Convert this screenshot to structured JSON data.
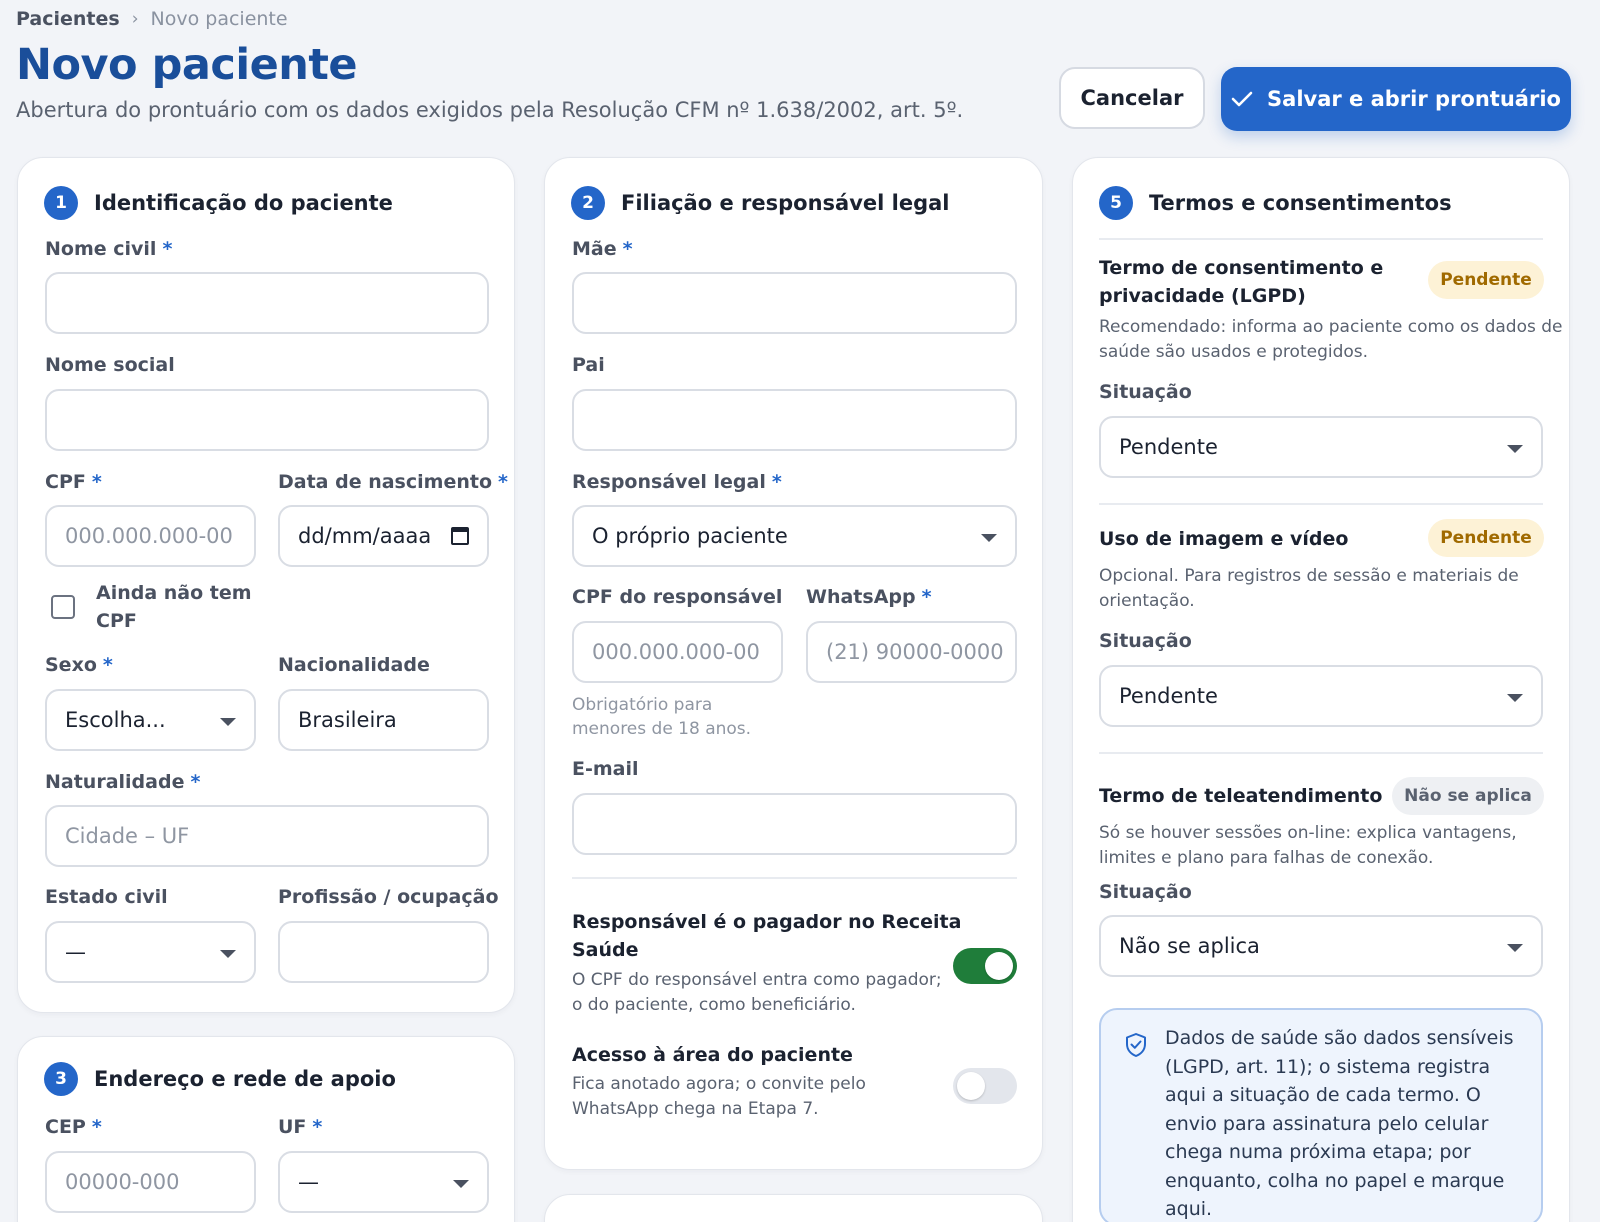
{
  "breadcrumb": {
    "parent": "Pacientes",
    "separator": "›",
    "current": "Novo paciente"
  },
  "page": {
    "title": "Novo paciente",
    "subtitle": "Abertura do prontuário com os dados exigidos pela Resolução CFM nº 1.638/2002, art. 5º."
  },
  "actions": {
    "cancel": "Cancelar",
    "save": "Salvar e abrir prontuário",
    "save_icon": "check-icon"
  },
  "colors": {
    "accent": "#2466c9",
    "title": "#1a4e9a",
    "toggle_on": "#1f7d3a",
    "pending_bg": "#fdf2d6",
    "pending_text": "#a06a00"
  },
  "identificacao": {
    "step": "1",
    "title": "Identificação do paciente",
    "nome_civil": {
      "label": "Nome civil",
      "required": "*",
      "value": ""
    },
    "nome_social": {
      "label": "Nome social",
      "value": ""
    },
    "cpf": {
      "label": "CPF",
      "required": "*",
      "placeholder": "000.000.000-00"
    },
    "nascimento": {
      "label": "Data de nascimento",
      "required": "*",
      "placeholder": "dd/mm/aaaa"
    },
    "sem_cpf": {
      "label_line1": "Ainda não tem",
      "label_line2": "CPF",
      "checked": false
    },
    "sexo": {
      "label": "Sexo",
      "required": "*",
      "value": "Escolha..."
    },
    "nacionalidade": {
      "label": "Nacionalidade",
      "value": "Brasileira"
    },
    "naturalidade": {
      "label": "Naturalidade",
      "required": "*",
      "placeholder": "Cidade – UF"
    },
    "estado_civil": {
      "label": "Estado civil",
      "value": "—"
    },
    "profissao": {
      "label": "Profissão / ocupação",
      "value": ""
    }
  },
  "endereco": {
    "step": "3",
    "title": "Endereço e rede de apoio",
    "cep": {
      "label": "CEP",
      "required": "*",
      "placeholder": "00000-000"
    },
    "uf": {
      "label": "UF",
      "required": "*",
      "value": "—"
    }
  },
  "filiacao": {
    "step": "2",
    "title": "Filiação e responsável legal",
    "mae": {
      "label": "Mãe",
      "required": "*",
      "value": ""
    },
    "pai": {
      "label": "Pai",
      "value": ""
    },
    "responsavel": {
      "label": "Responsável legal",
      "required": "*",
      "value": "O próprio paciente"
    },
    "cpf_responsavel": {
      "label": "CPF do responsável",
      "placeholder": "000.000.000-00",
      "help_line1": "Obrigatório para",
      "help_line2": "menores de 18 anos."
    },
    "whatsapp": {
      "label": "WhatsApp",
      "required": "*",
      "placeholder": "(21) 90000-0000"
    },
    "email": {
      "label": "E-mail",
      "value": ""
    },
    "pagador": {
      "title_line1": "Responsável é o pagador no Receita",
      "title_line2": "Saúde",
      "desc_line1": "O CPF do responsável entra como pagador;",
      "desc_line2": "o do paciente, como beneficiário.",
      "enabled": true
    },
    "acesso": {
      "title": "Acesso à área do paciente",
      "desc_line1": "Fica anotado agora; o convite pelo",
      "desc_line2": "WhatsApp chega na Etapa 7.",
      "enabled": false
    }
  },
  "termos": {
    "step": "5",
    "title": "Termos e consentimentos",
    "situacao_label": "Situação",
    "items": [
      {
        "title_line1": "Termo de consentimento e",
        "title_line2": "privacidade (LGPD)",
        "badge": "Pendente",
        "desc_line1": "Recomendado: informa ao paciente como os dados de",
        "desc_line2": "saúde são usados e protegidos.",
        "situacao": "Pendente"
      },
      {
        "title_line1": "Uso de imagem e vídeo",
        "badge": "Pendente",
        "desc_line1": "Opcional. Para registros de sessão e materiais de",
        "desc_line2": "orientação.",
        "situacao": "Pendente"
      },
      {
        "title_line1": "Termo de teleatendimento",
        "badge": "Não se aplica",
        "desc_line1": "Só se houver sessões on-line: explica vantagens,",
        "desc_line2": "limites e plano para falhas de conexão.",
        "situacao": "Não se aplica"
      }
    ],
    "info": {
      "icon": "shield-check-icon",
      "text": "Dados de saúde são dados sensíveis (LGPD, art. 11); o sistema registra aqui a situação de cada termo. O envio para assinatura pelo celular chega numa próxima etapa; por enquanto, colha no papel e marque aqui."
    }
  }
}
